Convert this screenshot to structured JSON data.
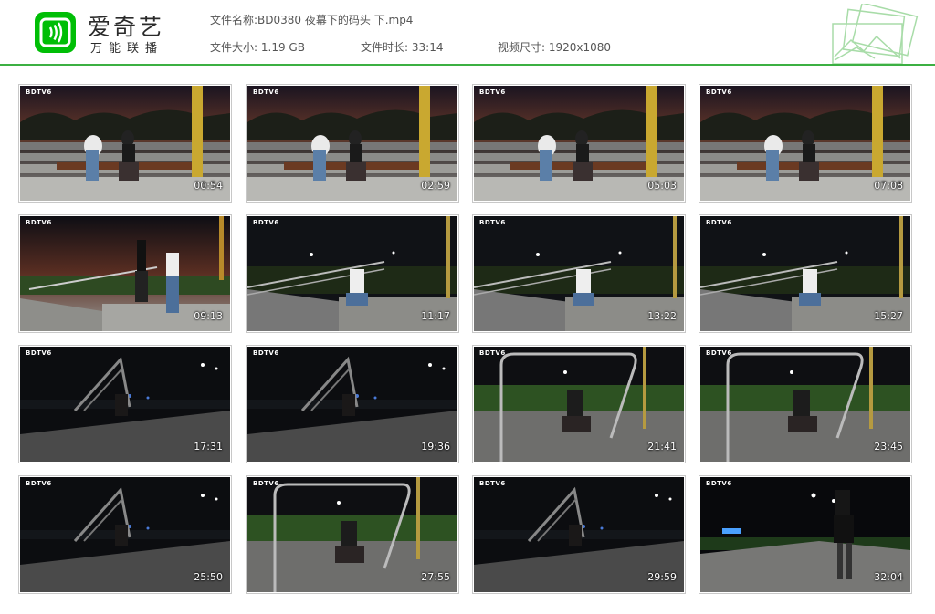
{
  "brand": {
    "name": "爱奇艺",
    "tagline": "万能联播"
  },
  "file": {
    "name_label": "文件名称:",
    "name_value": "BD0380 夜幕下的码头 下.mp4",
    "size_label": "文件大小:",
    "size_value": "1.19 GB",
    "duration_label": "文件时长:",
    "duration_value": "33:14",
    "dims_label": "视频尺寸:",
    "dims_value": "1920x1080"
  },
  "colors": {
    "brand_green": "#00be06",
    "rule_green": "#3cb043"
  },
  "thumbnails": [
    {
      "time": "00:54",
      "watermark": "BDTV6",
      "scene": "dusk-bench"
    },
    {
      "time": "02:59",
      "watermark": "BDTV6",
      "scene": "dusk-bench"
    },
    {
      "time": "05:03",
      "watermark": "BDTV6",
      "scene": "dusk-bench"
    },
    {
      "time": "07:08",
      "watermark": "BDTV6",
      "scene": "dusk-bench"
    },
    {
      "time": "09:13",
      "watermark": "BDTV6",
      "scene": "dusk-stairs"
    },
    {
      "time": "11:17",
      "watermark": "BDTV6",
      "scene": "night-stairs"
    },
    {
      "time": "13:22",
      "watermark": "BDTV6",
      "scene": "night-stairs"
    },
    {
      "time": "15:27",
      "watermark": "BDTV6",
      "scene": "night-stairs"
    },
    {
      "time": "17:31",
      "watermark": "BDTV6",
      "scene": "dark-rail"
    },
    {
      "time": "19:36",
      "watermark": "BDTV6",
      "scene": "dark-rail"
    },
    {
      "time": "21:41",
      "watermark": "BDTV6",
      "scene": "night-grass"
    },
    {
      "time": "23:45",
      "watermark": "BDTV6",
      "scene": "night-grass"
    },
    {
      "time": "25:50",
      "watermark": "BDTV6",
      "scene": "dark-rail"
    },
    {
      "time": "27:55",
      "watermark": "BDTV6",
      "scene": "night-grass"
    },
    {
      "time": "29:59",
      "watermark": "BDTV6",
      "scene": "dark-rail"
    },
    {
      "time": "32:04",
      "watermark": "BDTV6",
      "scene": "night-road"
    }
  ]
}
